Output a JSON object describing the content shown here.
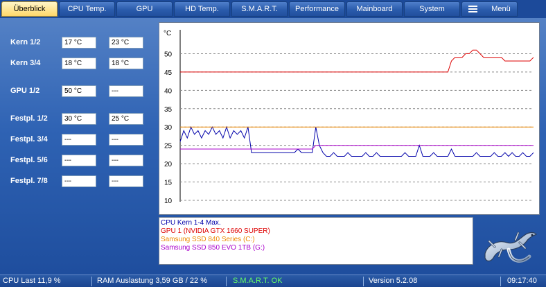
{
  "tabs": [
    {
      "label": "Überblick",
      "active": true
    },
    {
      "label": "CPU Temp."
    },
    {
      "label": "GPU"
    },
    {
      "label": "HD Temp."
    },
    {
      "label": "S.M.A.R.T."
    },
    {
      "label": "Performance"
    },
    {
      "label": "Mainboard"
    },
    {
      "label": "System"
    }
  ],
  "menu": {
    "label": "Menü",
    "icon": "hamburger-icon"
  },
  "temps": [
    {
      "label": "Kern 1/2",
      "v1": "17 °C",
      "v2": "23 °C"
    },
    {
      "label": "Kern 3/4",
      "v1": "18 °C",
      "v2": "18 °C"
    },
    {
      "label": "GPU 1/2",
      "v1": "50 °C",
      "v2": "---"
    },
    {
      "label": "Festpl. 1/2",
      "v1": "30 °C",
      "v2": "25 °C"
    },
    {
      "label": "Festpl. 3/4",
      "v1": "---",
      "v2": "---"
    },
    {
      "label": "Festpl. 5/6",
      "v1": "---",
      "v2": "---"
    },
    {
      "label": "Festpl. 7/8",
      "v1": "---",
      "v2": "---"
    }
  ],
  "chart": {
    "unit": "°C",
    "y_ticks": [
      "50",
      "45",
      "40",
      "35",
      "30",
      "25",
      "20",
      "15",
      "10"
    ]
  },
  "chart_data": {
    "type": "line",
    "ylabel": "°C",
    "ylim": [
      10,
      55
    ],
    "grid": true,
    "series": [
      {
        "name": "CPU Kern 1-4 Max.",
        "color": "#0000aa",
        "values": [
          26,
          29,
          27,
          30,
          28,
          29,
          27,
          29,
          28,
          30,
          28,
          29,
          27,
          30,
          27,
          29,
          28,
          29,
          27,
          30,
          23,
          23,
          23,
          23,
          23,
          23,
          23,
          23,
          23,
          23,
          23,
          23,
          23,
          24,
          23,
          23,
          23,
          23,
          30,
          25,
          23,
          22,
          22,
          23,
          22,
          22,
          22,
          23,
          22,
          22,
          22,
          22,
          23,
          22,
          22,
          23,
          22,
          22,
          22,
          22,
          22,
          22,
          22,
          23,
          22,
          22,
          22,
          25,
          22,
          22,
          22,
          23,
          22,
          22,
          22,
          22,
          24,
          22,
          22,
          22,
          22,
          22,
          22,
          23,
          22,
          22,
          22,
          22,
          23,
          22,
          22,
          23,
          22,
          23,
          22,
          22,
          23,
          22,
          22,
          23
        ]
      },
      {
        "name": "GPU 1 (NVIDIA GTX 1660 SUPER)",
        "color": "#dd0000",
        "values": [
          45,
          45,
          45,
          45,
          45,
          45,
          45,
          45,
          45,
          45,
          45,
          45,
          45,
          45,
          45,
          45,
          45,
          45,
          45,
          45,
          45,
          45,
          45,
          45,
          45,
          45,
          45,
          45,
          45,
          45,
          45,
          45,
          45,
          45,
          45,
          45,
          45,
          45,
          45,
          45,
          45,
          45,
          45,
          45,
          45,
          45,
          45,
          45,
          45,
          45,
          45,
          45,
          45,
          45,
          45,
          45,
          45,
          45,
          45,
          45,
          45,
          45,
          45,
          45,
          45,
          45,
          45,
          45,
          45,
          45,
          45,
          45,
          45,
          45,
          45,
          45,
          48,
          49,
          49,
          49,
          50,
          50,
          51,
          51,
          50,
          49,
          49,
          49,
          49,
          49,
          49,
          48,
          48,
          48,
          48,
          48,
          48,
          48,
          48,
          49
        ]
      },
      {
        "name": "Samsung SSD 840 Series (C:)",
        "color": "#ee8800",
        "values": [
          30,
          30,
          30,
          30,
          30,
          30,
          30,
          30,
          30,
          30,
          30,
          30,
          30,
          30,
          30,
          30,
          30,
          30,
          30,
          30,
          30,
          30,
          30,
          30,
          30,
          30,
          30,
          30,
          30,
          30,
          30,
          30,
          30,
          30,
          30,
          30,
          30,
          30,
          30,
          30,
          30,
          30,
          30,
          30,
          30,
          30,
          30,
          30,
          30,
          30,
          30,
          30,
          30,
          30,
          30,
          30,
          30,
          30,
          30,
          30,
          30,
          30,
          30,
          30,
          30,
          30,
          30,
          30,
          30,
          30,
          30,
          30,
          30,
          30,
          30,
          30,
          30,
          30,
          30,
          30,
          30,
          30,
          30,
          30,
          30,
          30,
          30,
          30,
          30,
          30,
          30,
          30,
          30,
          30,
          30,
          30,
          30,
          30,
          30,
          30
        ]
      },
      {
        "name": "Samsung SSD 850 EVO 1TB (G:)",
        "color": "#aa00cc",
        "values": [
          24,
          24,
          24,
          24,
          24,
          24,
          24,
          24,
          24,
          24,
          24,
          24,
          24,
          24,
          24,
          24,
          24,
          24,
          24,
          24,
          24,
          24,
          24,
          24,
          24,
          24,
          24,
          24,
          24,
          24,
          24,
          24,
          24,
          24,
          24,
          24,
          24,
          24,
          25,
          25,
          25,
          25,
          25,
          25,
          25,
          25,
          25,
          25,
          25,
          25,
          25,
          25,
          25,
          25,
          25,
          25,
          25,
          25,
          25,
          25,
          25,
          25,
          25,
          25,
          25,
          25,
          25,
          25,
          25,
          25,
          25,
          25,
          25,
          25,
          25,
          25,
          25,
          25,
          25,
          25,
          25,
          25,
          25,
          25,
          25,
          25,
          25,
          25,
          25,
          25,
          25,
          25,
          25,
          25,
          25,
          25,
          25,
          25,
          25,
          25
        ]
      }
    ]
  },
  "status": {
    "cpu": "CPU Last 11,9 %",
    "ram": "RAM Auslastung 3,59 GB / 22 %",
    "smart": "S.M.A.R.T. OK",
    "smart_color": "#66ff66",
    "version": "Version 5.2.08",
    "time": "09:17:40"
  }
}
